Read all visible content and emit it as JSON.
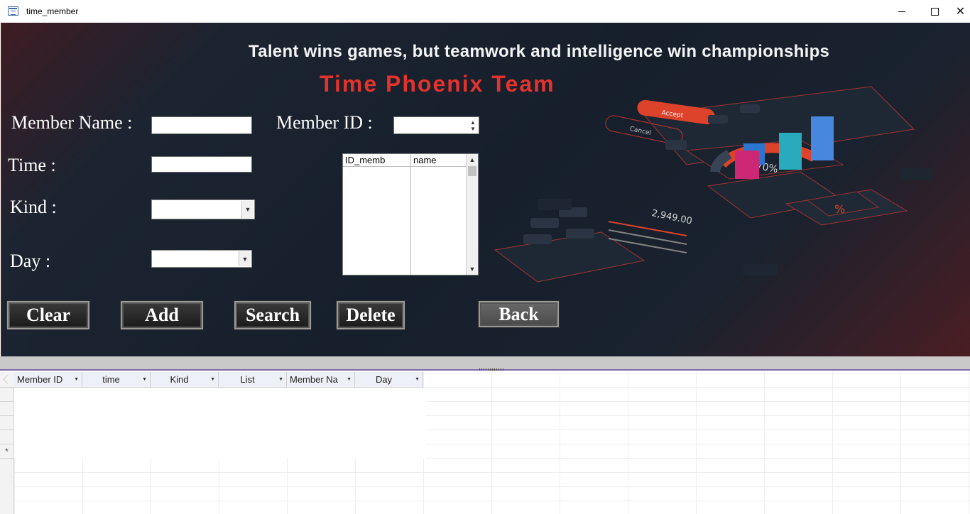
{
  "window": {
    "title": "time_member"
  },
  "banner": {
    "slogan": "Talent wins games, but teamwork and intelligence win championships",
    "team_name": "Time Phoenix Team",
    "graphic": {
      "accept_label": "Accept",
      "cancel_label": "Cancel",
      "percent_label": "70%",
      "amount_label": "2,949.00",
      "percent_icon": "%"
    }
  },
  "form": {
    "member_name_label": "Member Name :",
    "member_id_label": "Member ID :",
    "time_label": "Time :",
    "kind_label": "Kind :",
    "day_label": "Day :",
    "member_name_value": "",
    "member_id_value": "",
    "time_value": "",
    "kind_value": "",
    "day_value": ""
  },
  "listbox": {
    "columns": [
      "ID_memb",
      "name"
    ],
    "rows": []
  },
  "buttons": {
    "clear": "Clear",
    "add": "Add",
    "search": "Search",
    "delete": "Delete",
    "back": "Back"
  },
  "datasheet": {
    "columns": [
      "Member ID",
      "time",
      "Kind",
      "List",
      "Member Na",
      "Day"
    ],
    "new_record_marker": "*"
  }
}
